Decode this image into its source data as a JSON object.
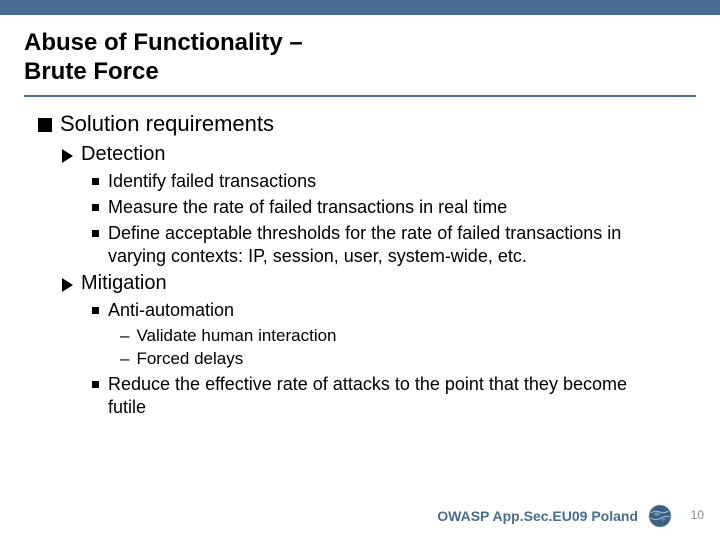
{
  "title_line1": "Abuse of Functionality –",
  "title_line2": "Brute Force",
  "lvl1": "Solution requirements",
  "detection": {
    "heading": "Detection",
    "items": [
      "Identify failed transactions",
      "Measure the rate of failed transactions in real time",
      "Define acceptable thresholds for the rate of failed transactions in varying contexts: IP, session, user, system-wide, etc."
    ]
  },
  "mitigation": {
    "heading": "Mitigation",
    "item1": "Anti-automation",
    "sub": [
      "Validate human interaction",
      "Forced delays"
    ],
    "item2": "Reduce the effective rate of attacks to the point that they become futile"
  },
  "footer": "OWASP App.Sec.EU09 Poland",
  "page": "10"
}
